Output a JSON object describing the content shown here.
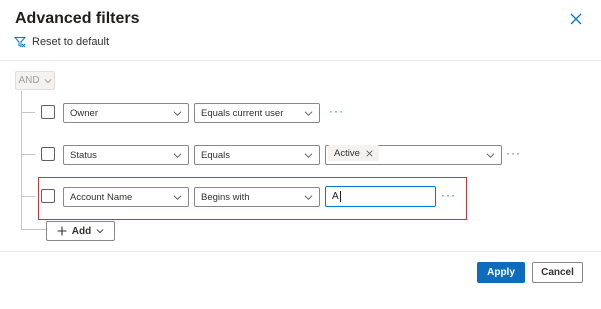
{
  "dialog": {
    "title": "Advanced filters",
    "reset_label": "Reset to default",
    "close_icon": "close-icon"
  },
  "group": {
    "operator": "AND"
  },
  "rows": [
    {
      "field": "Owner",
      "operator": "Equals current user"
    },
    {
      "field": "Status",
      "operator": "Equals",
      "value_tag": "Active"
    },
    {
      "field": "Account Name",
      "operator": "Begins with",
      "value": "A"
    }
  ],
  "add_label": "Add",
  "footer": {
    "apply_label": "Apply",
    "cancel_label": "Cancel"
  },
  "colors": {
    "accent": "#0f6cbd",
    "highlight_border": "#d13438"
  }
}
